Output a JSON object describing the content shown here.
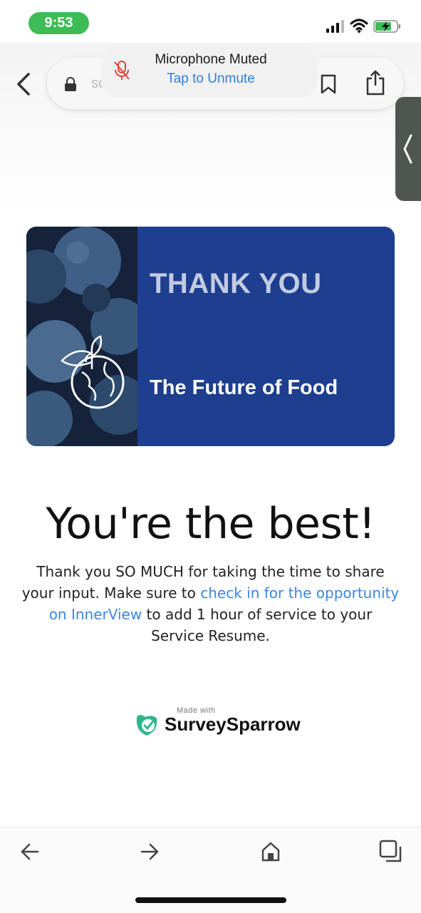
{
  "status_bar": {
    "time": "9:53",
    "icons": [
      "signal-icon",
      "wifi-icon",
      "battery-charging-icon"
    ]
  },
  "browser": {
    "url_fragment": "sc",
    "mic_toast": {
      "title": "Microphone Muted",
      "action": "Tap to Unmute"
    },
    "icons": [
      "back-chevron-icon",
      "lock-icon",
      "mic-muted-icon",
      "bookmark-icon",
      "share-icon",
      "side-panel-chevron-icon"
    ]
  },
  "banner": {
    "heading": "THANK YOU",
    "subtitle": "The Future of Food",
    "background_color": "#1e3f8f"
  },
  "content": {
    "headline": "You're the best!",
    "body_before": "Thank you SO MUCH for taking the time to share your input. Make sure to ",
    "body_link": "check in for the opportunity on InnerView",
    "body_after": " to add 1 hour of service to your Service Resume.",
    "link_color": "#3a86e0"
  },
  "footer": {
    "made_with": "Made with",
    "brand": "SurveySparrow",
    "brand_color": "#2fb58c"
  },
  "bottom_nav": {
    "icons": [
      "back-arrow-icon",
      "forward-arrow-icon",
      "home-icon",
      "tabs-icon"
    ]
  }
}
